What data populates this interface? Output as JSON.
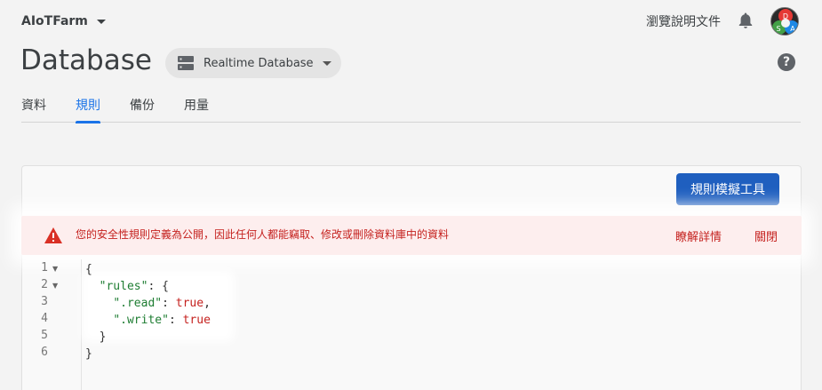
{
  "header": {
    "project_name": "AIoTFarm",
    "docs_link": "瀏覽說明文件",
    "bell_icon": "bell-icon",
    "avatar_letters": [
      "D",
      "S",
      "A"
    ]
  },
  "page": {
    "title": "Database",
    "db_selector": "Realtime Database",
    "help_icon": "?"
  },
  "tabs": [
    {
      "label": "資料",
      "active": false
    },
    {
      "label": "規則",
      "active": true
    },
    {
      "label": "備份",
      "active": false
    },
    {
      "label": "用量",
      "active": false
    }
  ],
  "toolbar": {
    "simulator_button": "規則模擬工具"
  },
  "warning": {
    "message": "您的安全性規則定義為公開，因此任何人都能竊取、修改或刪除資料庫中的資料",
    "learn_more": "瞭解詳情",
    "dismiss": "關閉"
  },
  "editor": {
    "line_numbers": [
      "1",
      "2",
      "3",
      "4",
      "5",
      "6"
    ],
    "lines": {
      "l1": "{",
      "l2_key": "\"rules\"",
      "l2_rest": ": {",
      "l3_key": "\".read\"",
      "l3_colon": ": ",
      "l3_val": "true",
      "l3_end": ",",
      "l4_key": "\".write\"",
      "l4_colon": ": ",
      "l4_val": "true",
      "l5": "}",
      "l6": "}"
    }
  },
  "colors": {
    "accent": "#1a73e8",
    "button": "#1f5fbf",
    "warning_text": "#c5221f",
    "warning_bg": "#fdeeee"
  }
}
